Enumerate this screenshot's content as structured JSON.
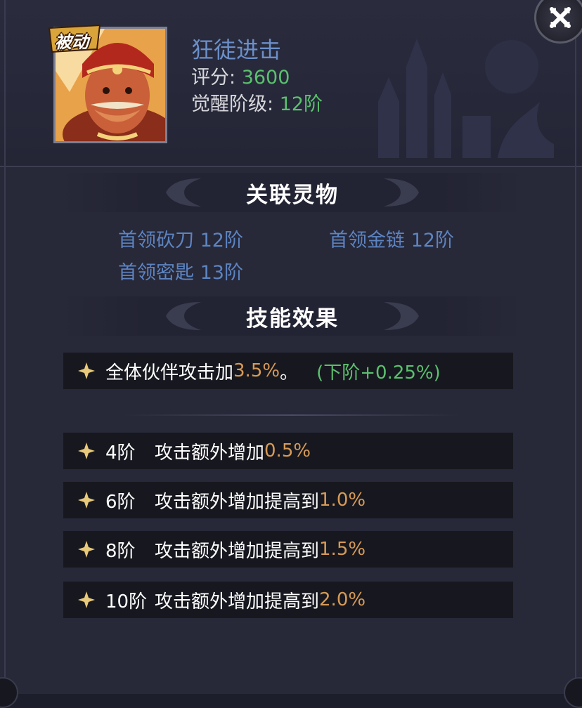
{
  "header": {
    "badge": "被动",
    "skill_name": "狂徒进击",
    "score_label": "评分:",
    "score_value": "3600",
    "awaken_label": "觉醒阶级:",
    "awaken_value": "12阶"
  },
  "linked": {
    "title": "关联灵物",
    "items": [
      {
        "label": "首领砍刀 12阶"
      },
      {
        "label": "首领金链 12阶"
      },
      {
        "label": "首领密匙 13阶"
      }
    ]
  },
  "skill": {
    "title": "技能效果",
    "base": {
      "text": "全体伙伴攻击加",
      "value": "3.5%",
      "suffix": "。",
      "next": "(下阶+0.25%)"
    },
    "tiers": [
      {
        "tier": "4阶",
        "text": "攻击额外增加",
        "value": "0.5%"
      },
      {
        "tier": "6阶",
        "text": "攻击额外增加提高到",
        "value": "1.0%"
      },
      {
        "tier": "8阶",
        "text": "攻击额外增加提高到",
        "value": "1.5%"
      },
      {
        "tier": "10阶",
        "text": "攻击额外增加提高到",
        "value": "2.0%"
      }
    ]
  },
  "colors": {
    "accent_blue": "#6b8fc9",
    "value_green": "#5bc06e",
    "value_orange": "#d79a56"
  },
  "icons": [
    "close-icon",
    "star-bullet-icon",
    "hero-portrait"
  ]
}
